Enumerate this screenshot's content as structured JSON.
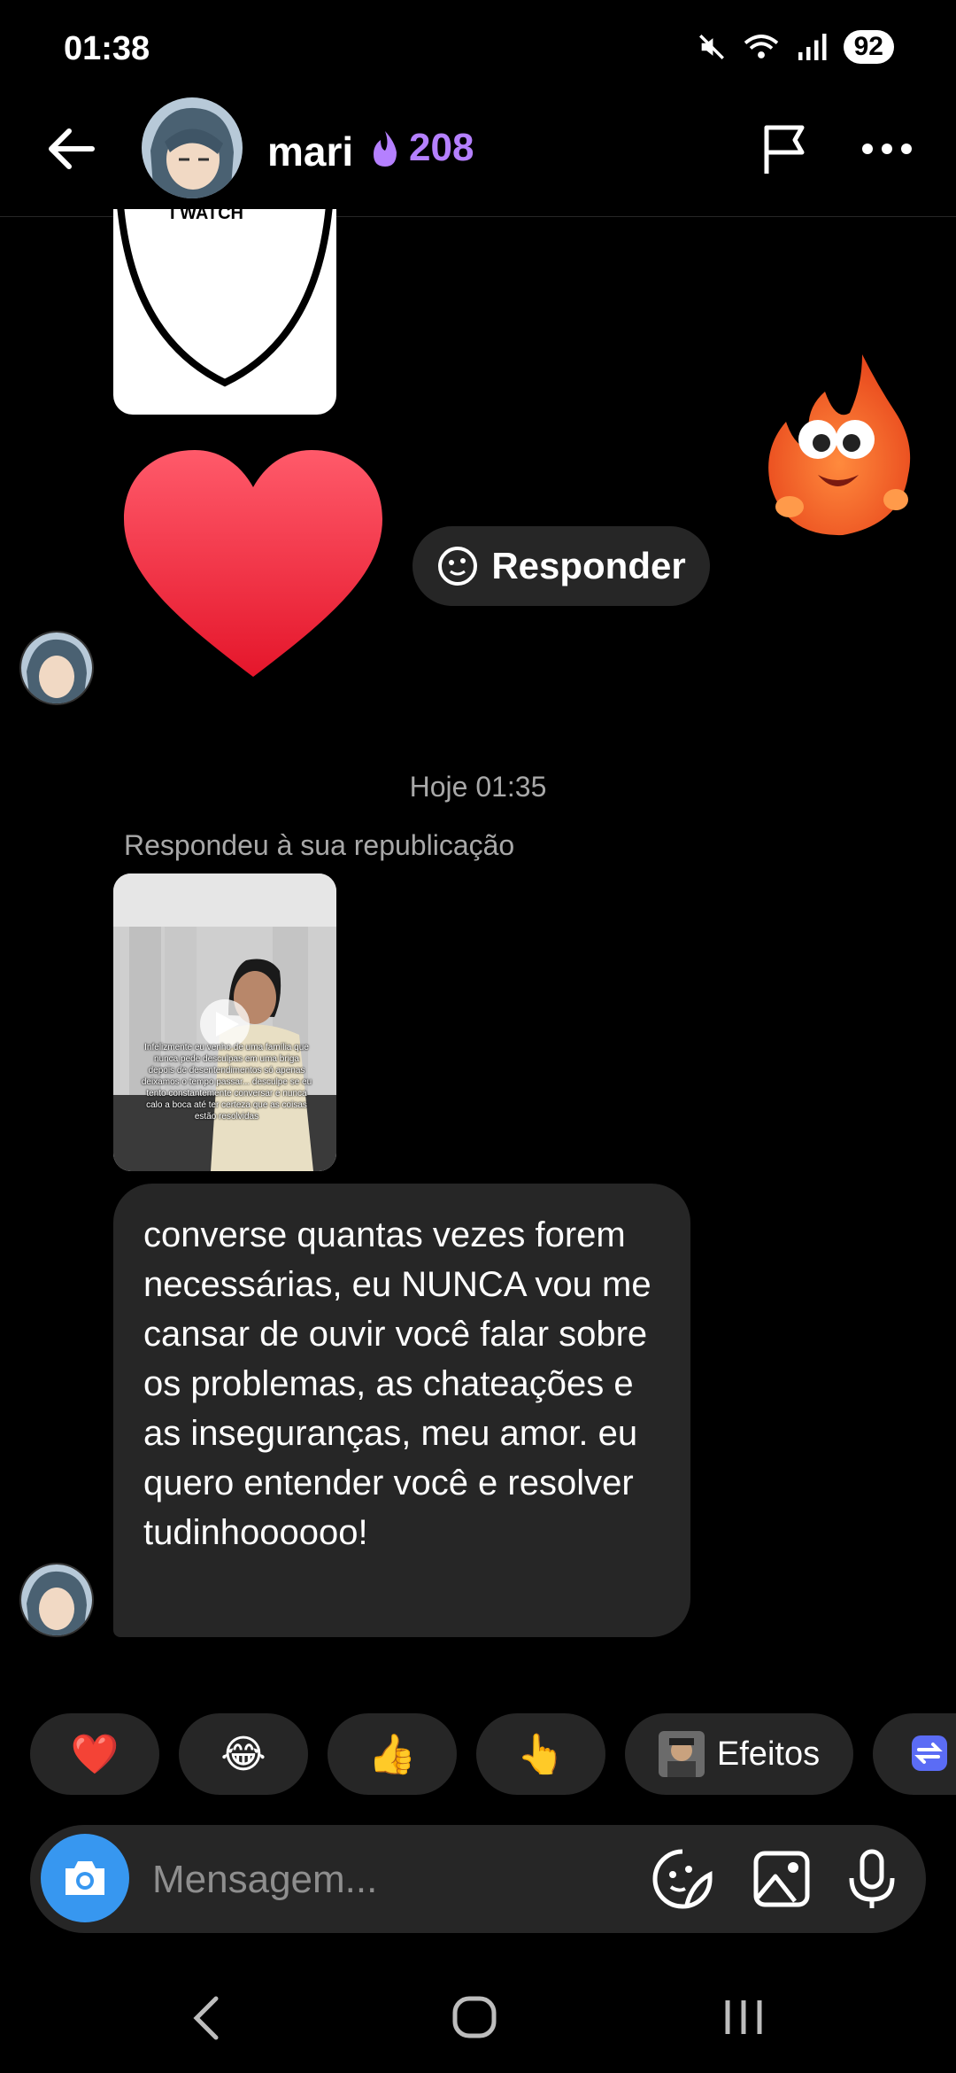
{
  "status_bar": {
    "time": "01:38",
    "battery": "92"
  },
  "header": {
    "name": "mari",
    "streak": "208"
  },
  "sticker": {
    "text": "I WATCH"
  },
  "reply_button": {
    "label": "Responder"
  },
  "chat": {
    "timestamp": "Hoje 01:35",
    "reply_label": "Respondeu à sua republicação",
    "video_overlay_text": "Infelizmente eu venho de uma família que nunca pede desculpas em uma briga depois de desentendimentos só apenas deixamos o tempo passar... desculpe se eu tento constantemente conversar e nunca calo a boca até ter certeza que as coisas estão resolvidas",
    "message": "converse quantas vezes forem necessárias, eu NUNCA vou me cansar de ouvir você falar sobre os problemas, as chateações e as inseguranças, meu amor. eu quero entender você e resolver tudinhoooooo!"
  },
  "reactions": [
    {
      "emoji": "❤️"
    },
    {
      "emoji": "😂"
    },
    {
      "emoji": "👍"
    },
    {
      "emoji": "👆"
    },
    {
      "label": "Efeitos"
    }
  ],
  "composer": {
    "placeholder": "Mensagem..."
  },
  "colors": {
    "accent": "#3797f0",
    "streak": "#b580ff",
    "bubble": "#262626"
  }
}
